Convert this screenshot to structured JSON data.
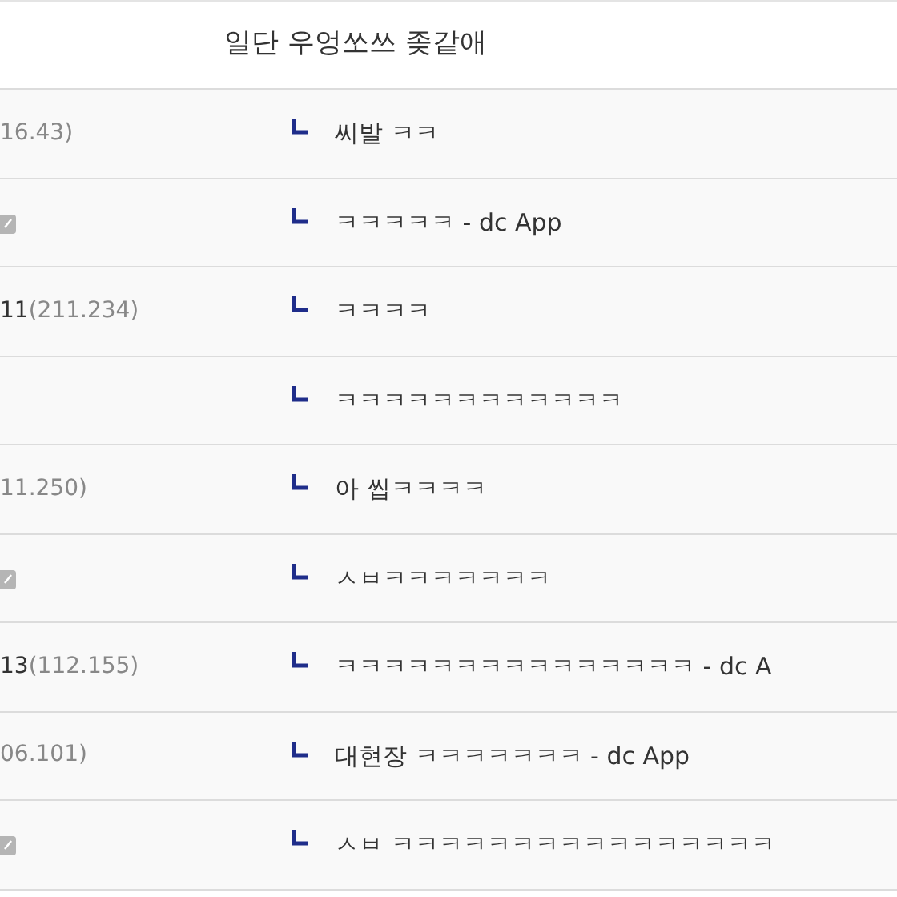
{
  "comment": {
    "text": "일단 우엉쏘쓰 좆같애"
  },
  "replies": [
    {
      "ip": "16.43)",
      "app_icon": false,
      "text": "씨발 ㅋㅋ"
    },
    {
      "app_icon": true,
      "text": "ㅋㅋㅋㅋㅋ - dc App"
    },
    {
      "nick": "11",
      "ip": "(211.234)",
      "app_icon": false,
      "text": "ㅋㅋㅋㅋ"
    },
    {
      "app_icon": false,
      "text": "ㅋㅋㅋㅋㅋㅋㅋㅋㅋㅋㅋㅋ"
    },
    {
      "ip": "11.250)",
      "app_icon": false,
      "text": "아 씹ㅋㅋㅋㅋ"
    },
    {
      "app_icon": true,
      "text": "ㅅㅂㅋㅋㅋㅋㅋㅋㅋ"
    },
    {
      "nick": "13",
      "ip": "(112.155)",
      "app_icon": false,
      "text": "ㅋㅋㅋㅋㅋㅋㅋㅋㅋㅋㅋㅋㅋㅋㅋ - dc A"
    },
    {
      "ip": "06.101)",
      "app_icon": false,
      "text": "대현장 ㅋㅋㅋㅋㅋㅋㅋ - dc App"
    },
    {
      "app_icon": true,
      "text": "ㅅㅂ ㅋㅋㅋㅋㅋㅋㅋㅋㅋㅋㅋㅋㅋㅋㅋㅋ"
    }
  ]
}
